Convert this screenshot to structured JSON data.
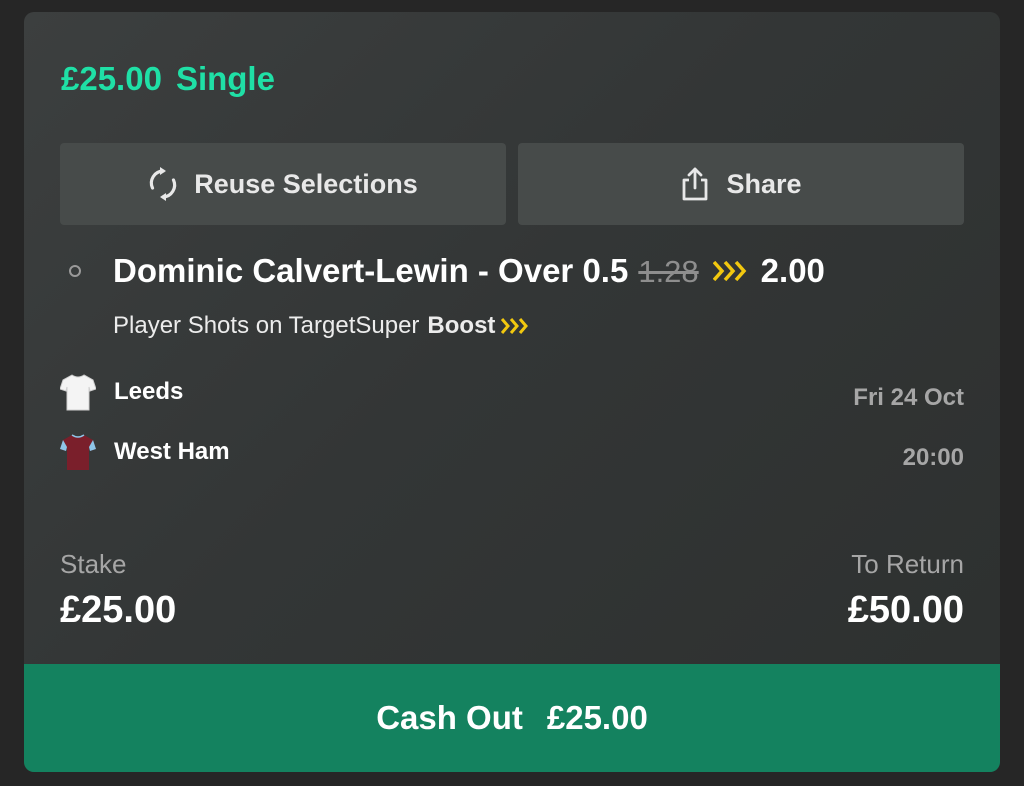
{
  "bet": {
    "stake_header": "£25.00",
    "type": "Single"
  },
  "actions": {
    "reuse_label": "Reuse Selections",
    "share_label": "Share"
  },
  "selection": {
    "name": "Dominic Calvert-Lewin - Over 0.5",
    "old_odds": "1.28",
    "new_odds": "2.00",
    "market": "Player Shots on Target",
    "boost_prefix": "Super",
    "boost_word": "Boost"
  },
  "event": {
    "home_team": "Leeds",
    "away_team": "West Ham",
    "date": "Fri 24 Oct",
    "time": "20:00"
  },
  "summary": {
    "stake_label": "Stake",
    "stake_value": "£25.00",
    "return_label": "To Return",
    "return_value": "£50.00"
  },
  "cashout": {
    "label": "Cash Out",
    "amount": "£25.00"
  },
  "icons": {
    "reuse": "refresh-icon",
    "share": "share-icon",
    "boost": "boost-chevrons-icon",
    "home_kit": "white-shirt-icon",
    "away_kit": "claret-shirt-icon"
  },
  "colors": {
    "accent_green": "#1fe0a6",
    "cashout_green": "#14825f",
    "boost_yellow": "#f2c80f",
    "card_bg": "#353838"
  }
}
